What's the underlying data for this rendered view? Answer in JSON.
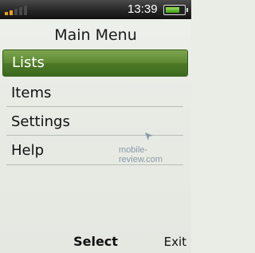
{
  "status": {
    "time": "13:39",
    "signal_bars": 2,
    "signal_max": 5,
    "battery_level": 0.75,
    "signal_color": "#e5a21a",
    "battery_color": "#5fc02a"
  },
  "header": {
    "title": "Main Menu"
  },
  "menu": {
    "items": [
      {
        "label": "Lists",
        "selected": true
      },
      {
        "label": "Items",
        "selected": false
      },
      {
        "label": "Settings",
        "selected": false
      },
      {
        "label": "Help",
        "selected": false
      }
    ],
    "selection_color": "#5f8a32"
  },
  "watermark": {
    "text": "mobile-review.com"
  },
  "softkeys": {
    "center": "Select",
    "right": "Exit"
  }
}
